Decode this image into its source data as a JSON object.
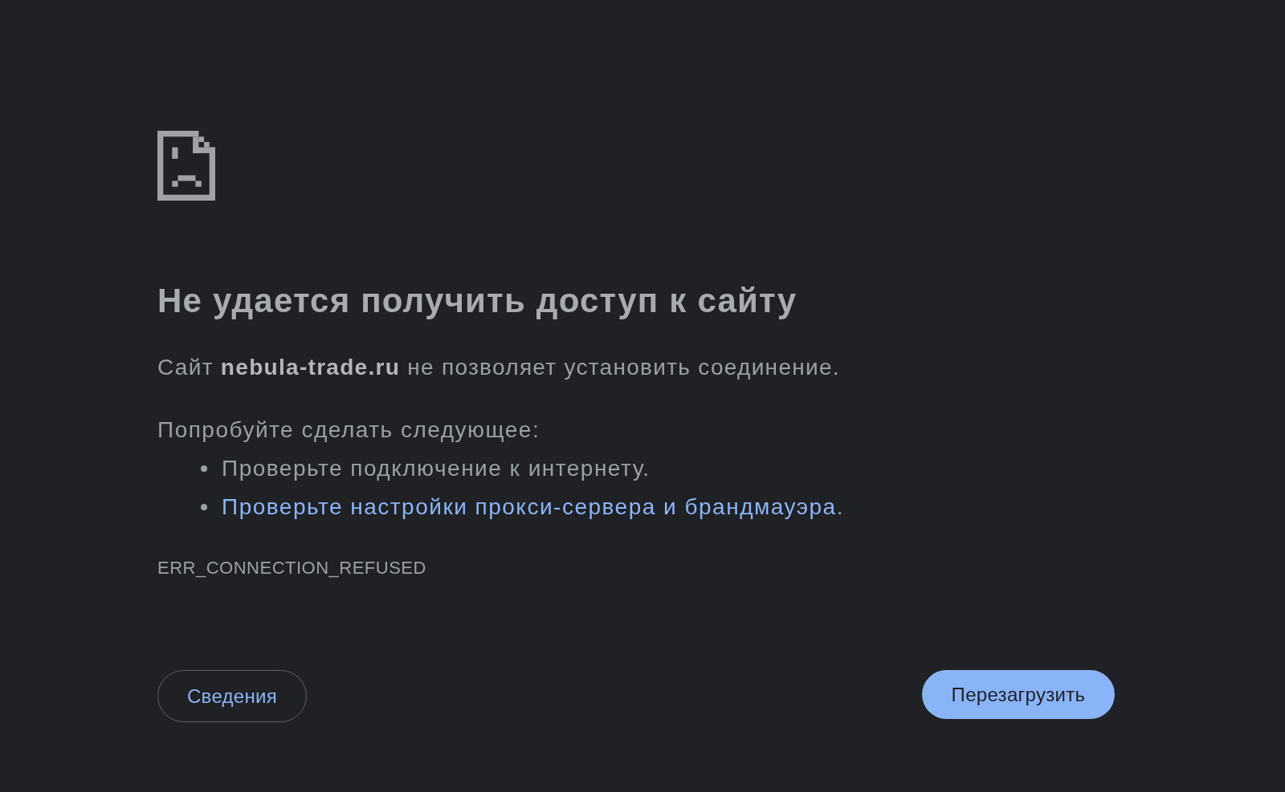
{
  "heading": "Не удается получить доступ к сайту",
  "message": "Сайт **nebula-trade.ru** не позволяет установить соединение.",
  "suggestions": {
    "title": "Попробуйте сделать следующее:",
    "items": [
      {
        "kind": "text",
        "text": "Проверьте подключение к интернету."
      },
      {
        "kind": "link",
        "text": "Проверьте настройки прокси-сервера и брандмауэра",
        "suffix": "."
      }
    ]
  },
  "error_code": "ERR_CONNECTION_REFUSED",
  "buttons": [
    {
      "kind": "secondary",
      "label": "Сведения"
    },
    {
      "kind": "primary",
      "label": "Перезагрузить"
    }
  ]
}
